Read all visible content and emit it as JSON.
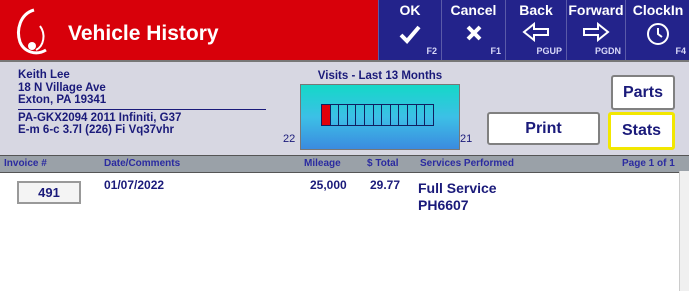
{
  "header": {
    "title": "Vehicle History",
    "buttons": [
      {
        "label": "OK",
        "key": "F2",
        "icon": "checkmark-icon"
      },
      {
        "label": "Cancel",
        "key": "F1",
        "icon": "cancel-x-icon"
      },
      {
        "label": "Back",
        "key": "PGUP",
        "icon": "arrow-left-icon"
      },
      {
        "label": "Forward",
        "key": "PGDN",
        "icon": "arrow-right-icon"
      },
      {
        "label": "ClockIn",
        "key": "F4",
        "icon": "clock-icon"
      }
    ]
  },
  "customer": {
    "name": "Keith Lee",
    "address1": "18 N Village Ave",
    "address2": "Exton, PA 19341",
    "vehicle": "PA-GKX2094   2011  Infiniti, G37",
    "engine": "E-m  6-c 3.7l (226) Fi   Vq37vhr"
  },
  "visits_chart": {
    "title": "Visits - Last 13 Months",
    "start_label": "22",
    "end_label": "21",
    "month_count": 13,
    "active_months": [
      1
    ]
  },
  "actions": {
    "parts": "Parts",
    "print": "Print",
    "stats": "Stats"
  },
  "columns": {
    "invoice": "Invoice #",
    "date": "Date/Comments",
    "mileage": "Mileage",
    "total": "$ Total",
    "services": "Services Performed",
    "page": "Page 1 of 1"
  },
  "rows": [
    {
      "invoice": "491",
      "date": "01/07/2022",
      "mileage": "25,000",
      "total": "29.77",
      "service_line1": "Full Service",
      "service_line2": "PH6607"
    }
  ],
  "colors": {
    "titlebar": "#d8000a",
    "toolbar": "#23238b",
    "text": "#1a1a7a",
    "highlight": "#f2e700"
  }
}
